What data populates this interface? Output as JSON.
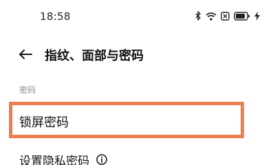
{
  "status_bar": {
    "time": "18:58",
    "icons": [
      "bluetooth-icon",
      "wifi-icon",
      "sim-icon",
      "battery-icon",
      "charging-icon"
    ]
  },
  "header": {
    "back_icon": "back-arrow-icon",
    "title": "指纹、面部与密码"
  },
  "section": {
    "label": "密码"
  },
  "items": [
    {
      "label": "锁屏密码"
    },
    {
      "label": "设置隐私密码",
      "icon": "info-icon"
    }
  ],
  "colors": {
    "highlight": "#ef7d4f"
  }
}
